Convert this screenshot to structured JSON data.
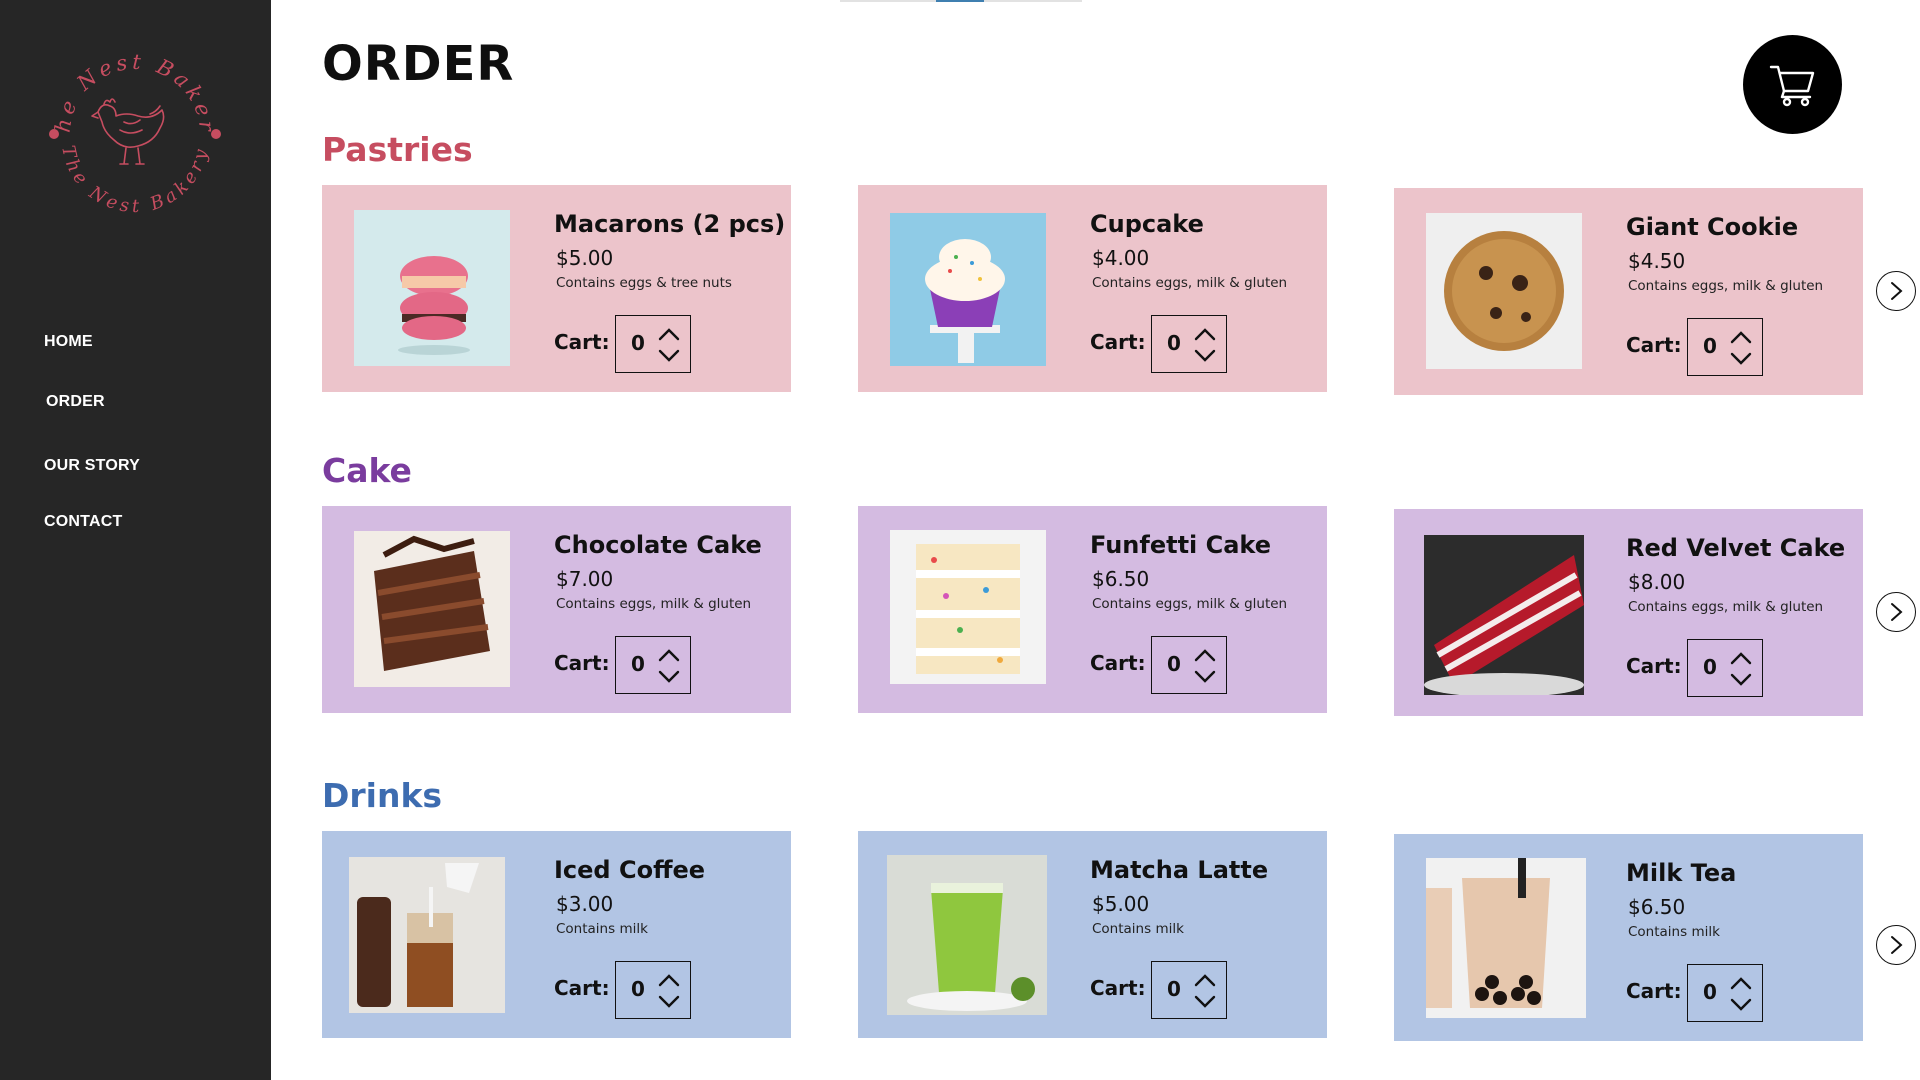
{
  "brand": {
    "logo_top_text": "The Nest Bakery",
    "logo_bottom_text": "The Nest Bakery"
  },
  "nav": {
    "items": [
      {
        "label": "HOME"
      },
      {
        "label": "ORDER"
      },
      {
        "label": "OUR STORY"
      },
      {
        "label": "CONTACT"
      }
    ]
  },
  "page": {
    "title": "ORDER",
    "cart_icon": "shopping-cart-icon"
  },
  "colors": {
    "sidebar": "#262626",
    "pastries_title": "#c64d60",
    "cake_title": "#7a3c9e",
    "drinks_title": "#3d6cb0",
    "pastries_card": "#ecc4cb",
    "cake_card": "#d4bbe1",
    "drinks_card": "#b2c5e4",
    "logo": "#c64d60"
  },
  "sections": [
    {
      "title": "Pastries",
      "items": [
        {
          "name": "Macarons (2 pcs)",
          "price": "$5.00",
          "allergens": "Contains eggs & tree nuts",
          "cart_label": "Cart:",
          "qty": "0",
          "image": "macaron-image"
        },
        {
          "name": "Cupcake",
          "price": "$4.00",
          "allergens": "Contains eggs, milk & gluten",
          "cart_label": "Cart:",
          "qty": "0",
          "image": "cupcake-image"
        },
        {
          "name": "Giant Cookie",
          "price": "$4.50",
          "allergens": "Contains eggs, milk & gluten",
          "cart_label": "Cart:",
          "qty": "0",
          "image": "cookie-image"
        }
      ]
    },
    {
      "title": "Cake",
      "items": [
        {
          "name": "Chocolate Cake",
          "price": "$7.00",
          "allergens": "Contains eggs, milk & gluten",
          "cart_label": "Cart:",
          "qty": "0",
          "image": "chocolate-cake-image"
        },
        {
          "name": "Funfetti Cake",
          "price": "$6.50",
          "allergens": "Contains eggs, milk & gluten",
          "cart_label": "Cart:",
          "qty": "0",
          "image": "funfetti-cake-image"
        },
        {
          "name": "Red Velvet Cake",
          "price": "$8.00",
          "allergens": "Contains eggs, milk & gluten",
          "cart_label": "Cart:",
          "qty": "0",
          "image": "red-velvet-cake-image"
        }
      ]
    },
    {
      "title": "Drinks",
      "items": [
        {
          "name": "Iced Coffee",
          "price": "$3.00",
          "allergens": "Contains milk",
          "cart_label": "Cart:",
          "qty": "0",
          "image": "iced-coffee-image"
        },
        {
          "name": "Matcha Latte",
          "price": "$5.00",
          "allergens": "Contains milk",
          "cart_label": "Cart:",
          "qty": "0",
          "image": "matcha-latte-image"
        },
        {
          "name": "Milk Tea",
          "price": "$6.50",
          "allergens": "Contains milk",
          "cart_label": "Cart:",
          "qty": "0",
          "image": "milk-tea-image"
        }
      ]
    }
  ]
}
